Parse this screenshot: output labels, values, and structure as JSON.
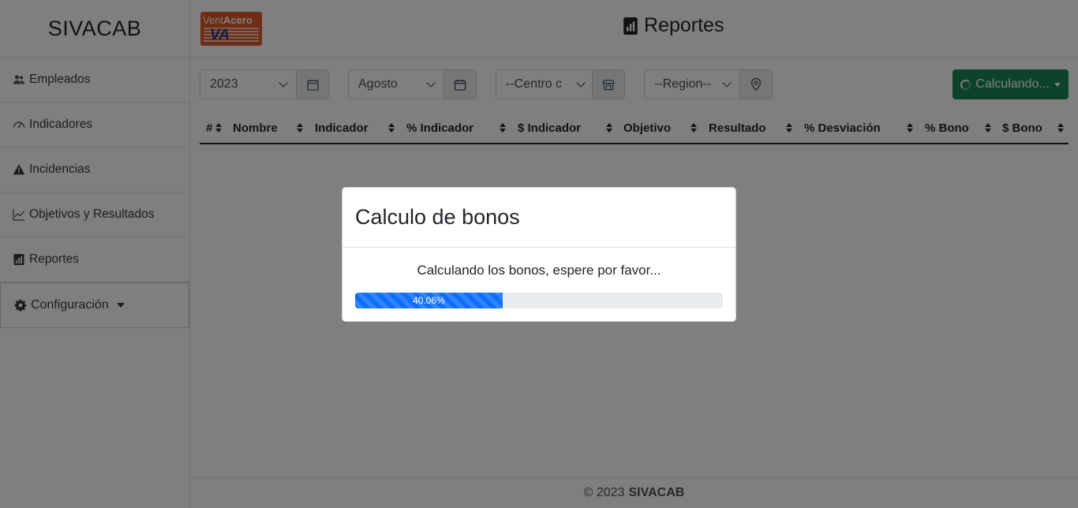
{
  "app": {
    "brand": "SIVACAB"
  },
  "sidebar": {
    "items": [
      {
        "label": "Empleados",
        "icon": "users-icon"
      },
      {
        "label": "Indicadores",
        "icon": "gauge-icon"
      },
      {
        "label": "Incidencias",
        "icon": "warning-icon"
      },
      {
        "label": "Objetivos y Resultados",
        "icon": "line-chart-icon"
      },
      {
        "label": "Reportes",
        "icon": "bar-chart-icon"
      }
    ],
    "config_label": "Configuración"
  },
  "header": {
    "logo_text_light": "Vent",
    "logo_text_bold": "Acero",
    "logo_mark": "VA",
    "title": "Reportes"
  },
  "filters": {
    "year": "2023",
    "month": "Agosto",
    "center": "--Centro c",
    "region": "--Region--",
    "calc_button": "Calculando..."
  },
  "table": {
    "columns": [
      "#",
      "Nombre",
      "Indicador",
      "% Indicador",
      "$ Indicador",
      "Objetivo",
      "Resultado",
      "% Desviación",
      "% Bono",
      "$ Bono"
    ]
  },
  "footer": {
    "copyright": "© 2023",
    "brand": "SIVACAB"
  },
  "modal": {
    "title": "Calculo de bonos",
    "message": "Calculando los bonos, espere por favor...",
    "progress_value": 40.06,
    "progress_label": "40.06%"
  },
  "colors": {
    "accent": "#0d6efd",
    "success": "#198754",
    "logo": "#e05a2a"
  }
}
